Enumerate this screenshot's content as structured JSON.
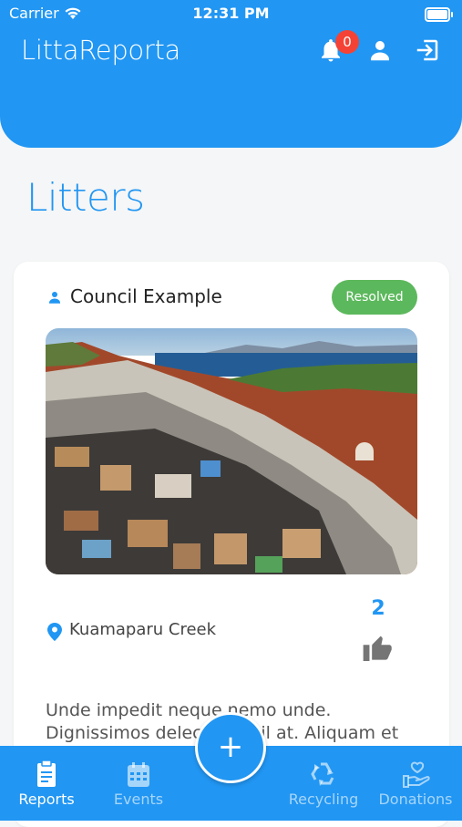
{
  "status_bar": {
    "carrier": "Carrier",
    "time": "12:31 PM"
  },
  "header": {
    "title": "LittaReporta",
    "notifications_count": "0",
    "icons": {
      "bell": "bell-icon",
      "user": "user-icon",
      "logout": "logout-icon"
    }
  },
  "page": {
    "title": "Litters"
  },
  "report": {
    "author": "Council Example",
    "status": "Resolved",
    "location": "Kuamaparu Creek",
    "likes": "2",
    "description": "Unde impedit neque nemo unde. Dignissimos delectus nihil at. Aliquam et dolores"
  },
  "fab": {
    "label": "+"
  },
  "nav": {
    "items": [
      {
        "label": "Reports",
        "icon": "clipboard-icon",
        "active": true
      },
      {
        "label": "Events",
        "icon": "calendar-icon",
        "active": false
      },
      {
        "label": "Recycling",
        "icon": "recycle-icon",
        "active": false
      },
      {
        "label": "Donations",
        "icon": "donation-hand-heart-icon",
        "active": false
      }
    ]
  },
  "colors": {
    "primary": "#2196f3",
    "badge_red": "#f44336",
    "resolved_green": "#5cb85c"
  }
}
